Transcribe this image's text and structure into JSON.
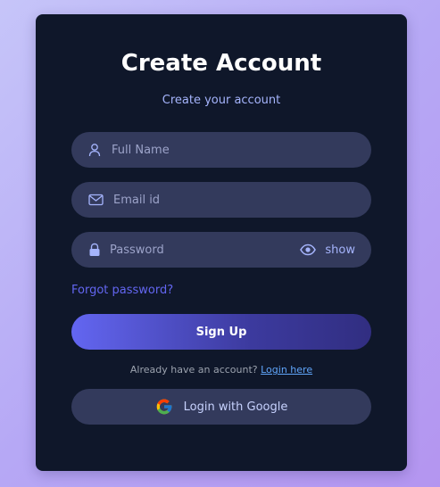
{
  "form": {
    "title": "Create Account",
    "subtitle": "Create your account",
    "fields": [
      {
        "placeholder": "Full Name",
        "icon": "person-icon",
        "value": ""
      },
      {
        "placeholder": "Email id",
        "icon": "mail-icon",
        "value": ""
      },
      {
        "placeholder": "Password",
        "icon": "lock-icon",
        "value": ""
      }
    ],
    "show_password_label": "show",
    "forgot_password_label": "Forgot password?",
    "submit_label": "Sign Up",
    "login_prompt": "Already have an account?",
    "login_link_label": "Login here",
    "google_label": "Login with Google"
  },
  "colors": {
    "card_background": "#0f172a",
    "field_background": "#333a5c",
    "accent": "#6366f1",
    "link": "#60a5fa"
  }
}
